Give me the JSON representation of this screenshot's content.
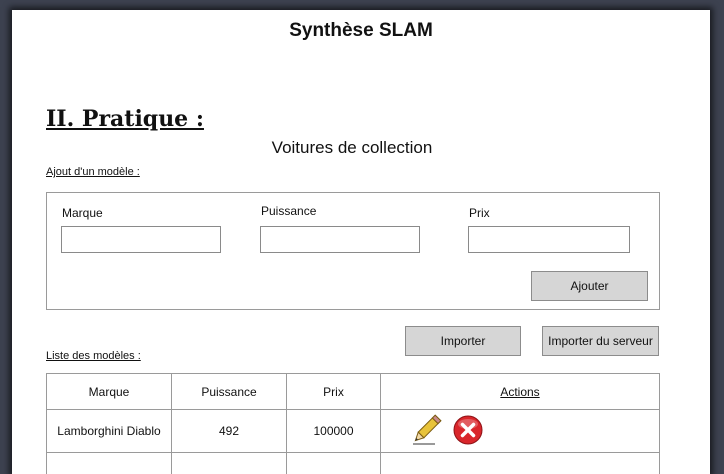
{
  "document": {
    "title": "Synthèse SLAM",
    "section_heading": "II. Pratique :"
  },
  "app": {
    "title": "Voitures de collection",
    "add_section_label": "Ajout d'un modèle :",
    "list_section_label": "Liste des modèles :",
    "form": {
      "marque_label": "Marque",
      "puissance_label": "Puissance",
      "prix_label": "Prix",
      "marque_value": "",
      "puissance_value": "",
      "prix_value": "",
      "add_button_label": "Ajouter"
    },
    "toolbar": {
      "import_label": "Importer",
      "import_server_label": "Importer du serveur"
    },
    "table": {
      "columns": [
        "Marque",
        "Puissance",
        "Prix",
        "Actions"
      ],
      "rows": [
        {
          "marque": "Lamborghini Diablo",
          "puissance": "492",
          "prix": "100000"
        },
        {
          "marque": "",
          "puissance": "",
          "prix": ""
        }
      ]
    },
    "icons": {
      "edit": "pencil-icon",
      "delete": "delete-icon"
    },
    "colors": {
      "delete_red": "#d9262b",
      "pencil_yellow": "#e8c33a",
      "button_gray": "#d6d6d6"
    }
  }
}
